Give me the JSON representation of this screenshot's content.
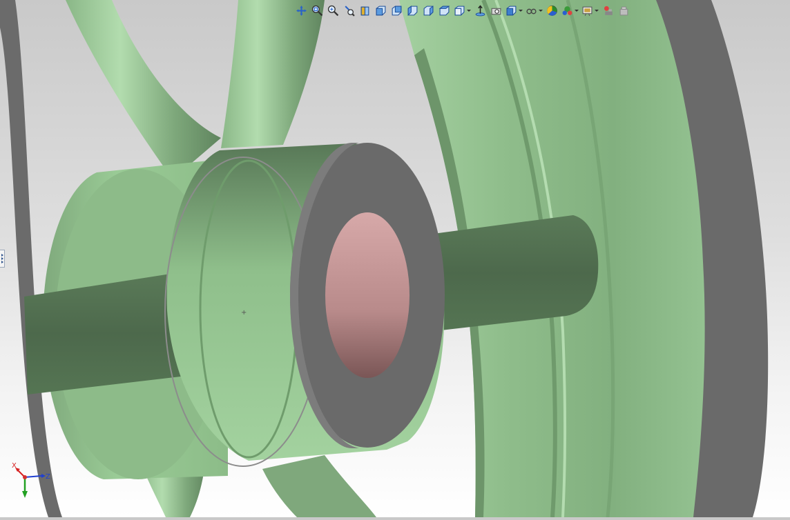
{
  "viewport": {
    "model": "wheel-hub-assembly",
    "origin_marker": "+"
  },
  "toolbar": {
    "items": [
      {
        "name": "pan-icon"
      },
      {
        "name": "zoom-to-area-icon"
      },
      {
        "name": "zoom-to-fit-icon"
      },
      {
        "name": "previous-view-icon"
      },
      {
        "name": "section-view-icon"
      },
      {
        "name": "view-front-icon"
      },
      {
        "name": "view-back-icon"
      },
      {
        "name": "view-left-icon"
      },
      {
        "name": "view-right-icon"
      },
      {
        "name": "view-top-icon"
      },
      {
        "name": "view-orientation-icon",
        "dropdown": true
      },
      {
        "name": "normal-to-icon"
      },
      {
        "name": "display-pane-icon"
      },
      {
        "name": "display-style-icon",
        "dropdown": true
      },
      {
        "name": "hide-show-items-icon",
        "dropdown": true
      },
      {
        "name": "edit-appearance-icon"
      },
      {
        "name": "apply-scene-icon",
        "dropdown": true
      },
      {
        "name": "view-settings-icon",
        "dropdown": true
      },
      {
        "name": "render-tools-icon"
      },
      {
        "name": "photoview-icon"
      }
    ]
  },
  "triad": {
    "x_label": "X",
    "y_label": "Y",
    "z_label": "Z",
    "x_color": "#d62020",
    "y_color": "#22a022",
    "z_color": "#2040d0"
  },
  "colors": {
    "part_green": "#90bf8c",
    "part_green_dark": "#4f6a4f",
    "section_gray": "#6a6a6a",
    "bore_pink": "#c08e8e"
  }
}
